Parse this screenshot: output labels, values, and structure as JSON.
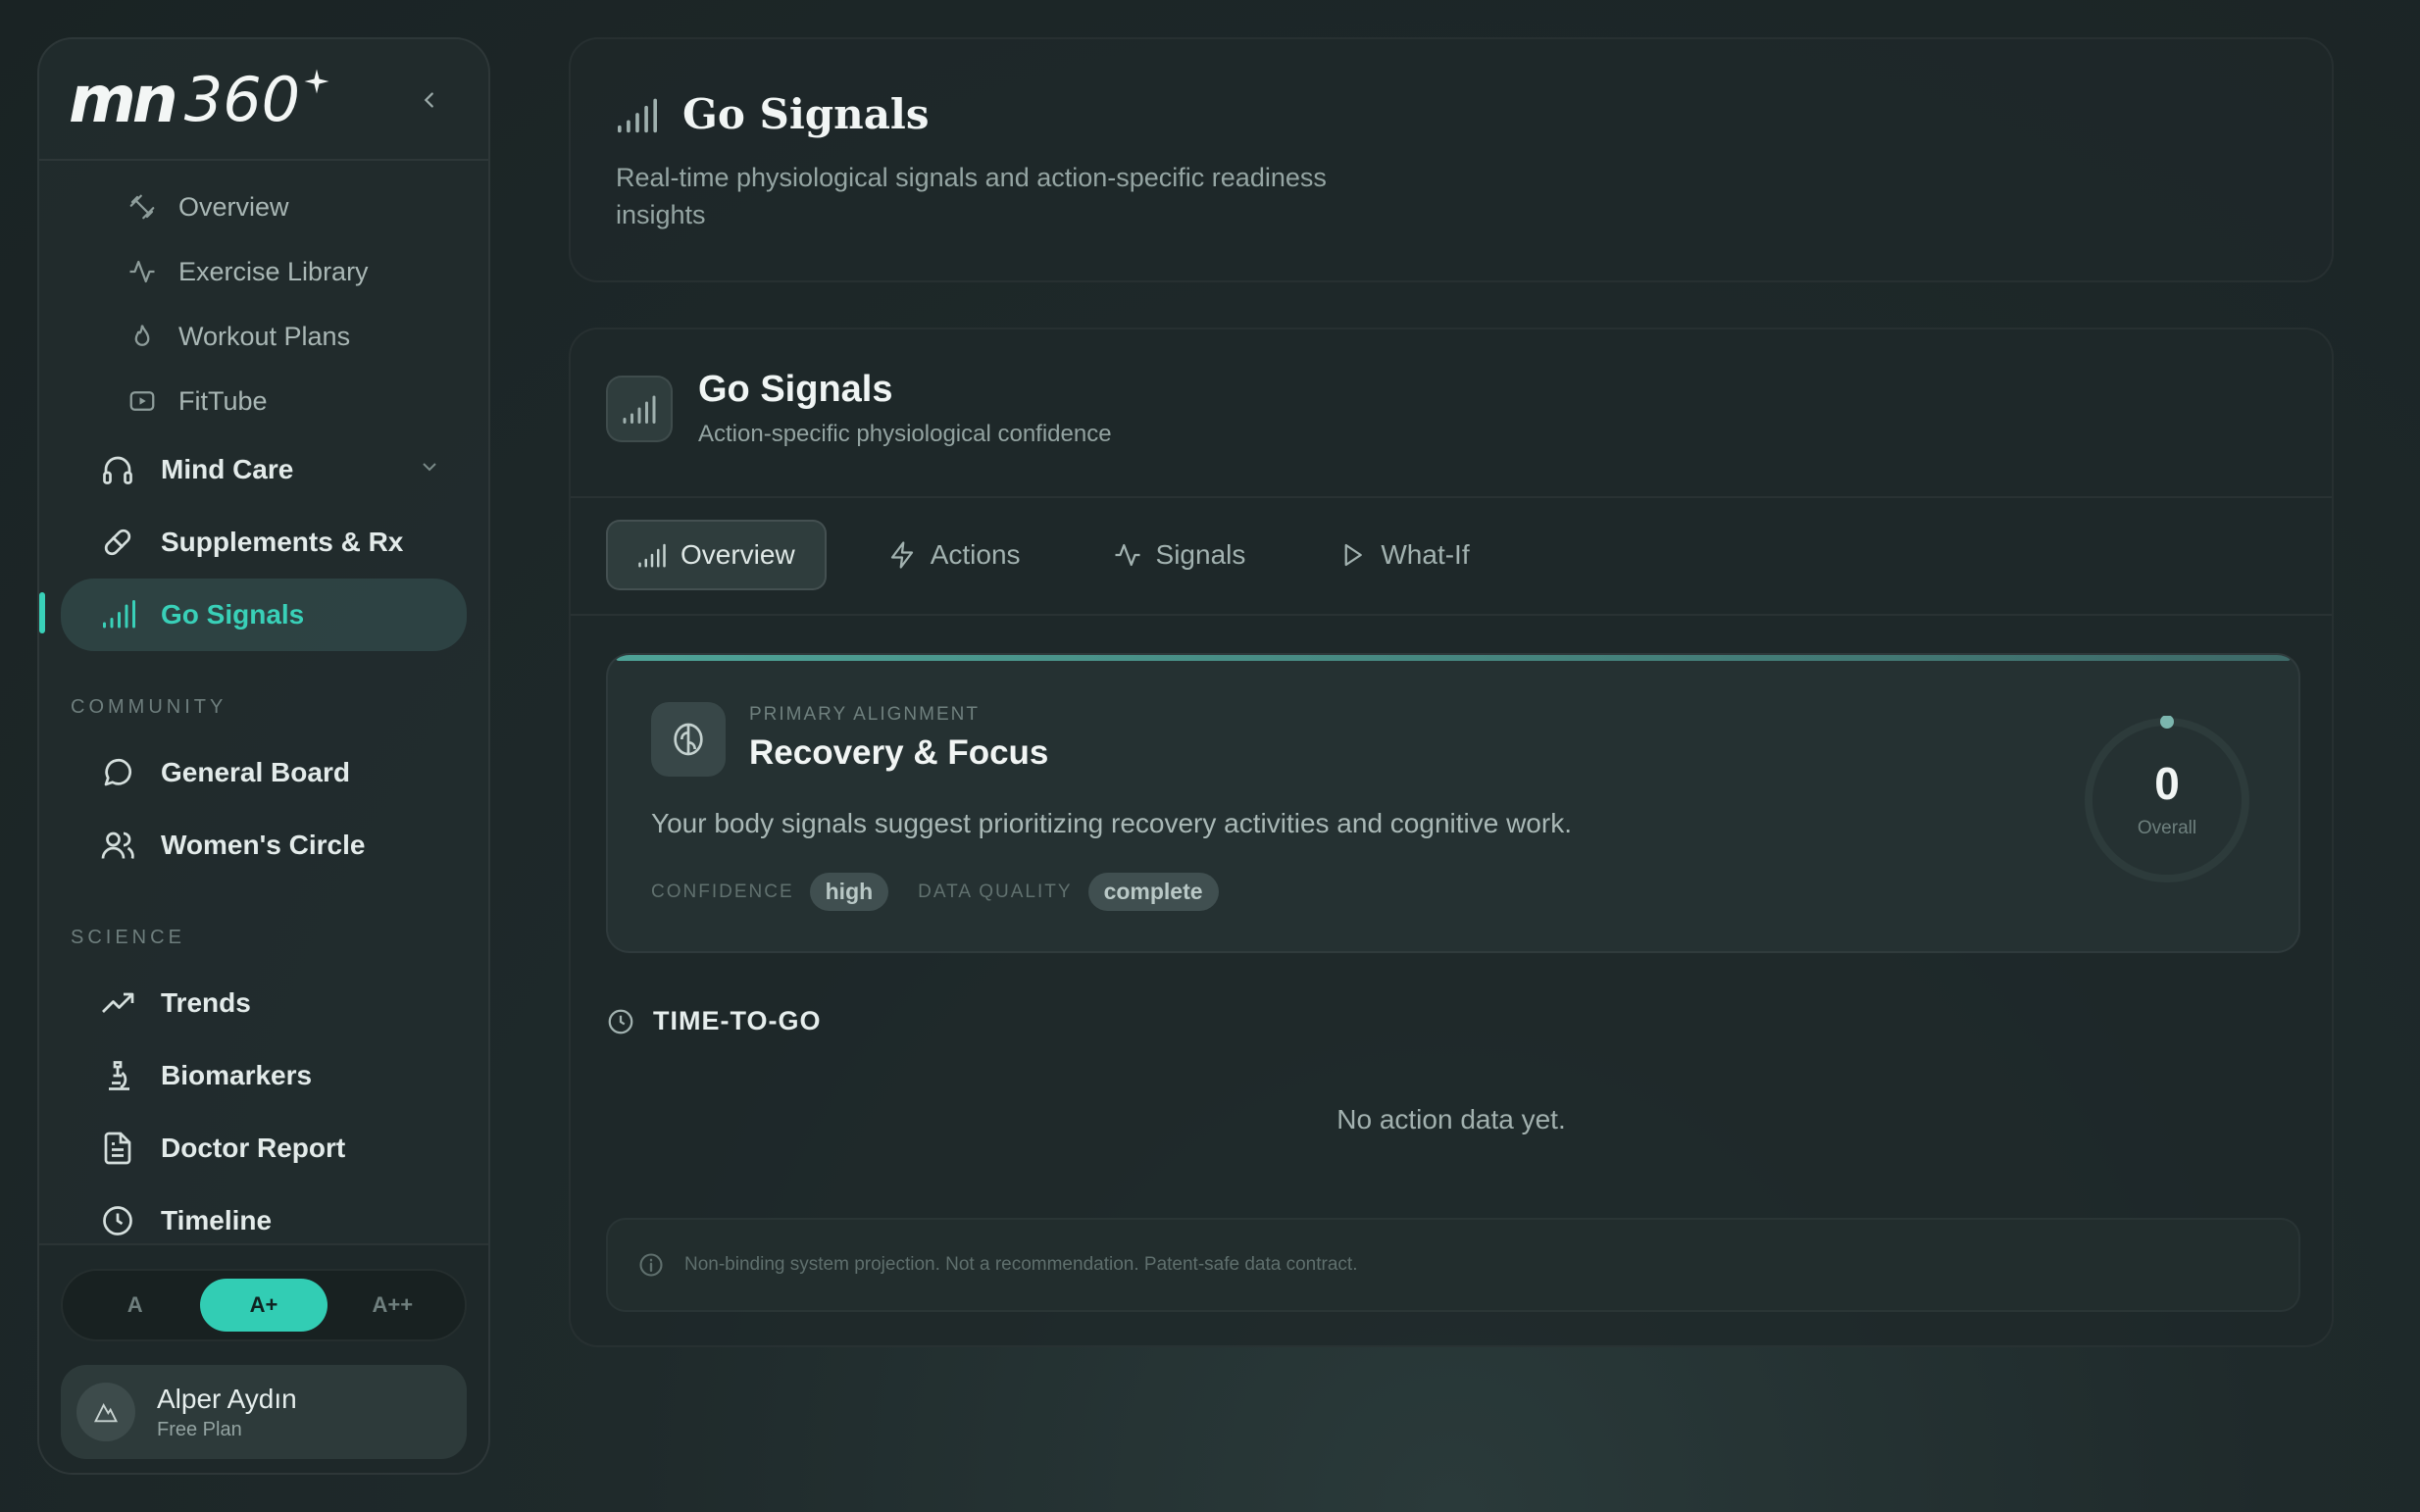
{
  "brand": {
    "mn": "mn",
    "num": "360"
  },
  "sidebar": {
    "sub_items": [
      {
        "label": "Overview",
        "icon": "dumbbell-icon"
      },
      {
        "label": "Exercise Library",
        "icon": "activity-icon"
      },
      {
        "label": "Workout Plans",
        "icon": "flame-icon"
      },
      {
        "label": "FitTube",
        "icon": "video-icon"
      }
    ],
    "items": [
      {
        "label": "Mind Care",
        "icon": "headphones-icon"
      },
      {
        "label": "Supplements & Rx",
        "icon": "pill-icon"
      },
      {
        "label": "Go Signals",
        "icon": "signal-icon"
      }
    ],
    "community_label": "COMMUNITY",
    "community": [
      {
        "label": "General Board",
        "icon": "message-circle-icon"
      },
      {
        "label": "Women's Circle",
        "icon": "users-icon"
      }
    ],
    "science_label": "SCIENCE",
    "science": [
      {
        "label": "Trends",
        "icon": "trending-up-icon"
      },
      {
        "label": "Biomarkers",
        "icon": "microscope-icon"
      },
      {
        "label": "Doctor Report",
        "icon": "file-text-icon"
      },
      {
        "label": "Timeline",
        "icon": "clock-icon"
      }
    ],
    "text_size": {
      "options": [
        "A",
        "A+",
        "A++"
      ],
      "selected": "A+"
    },
    "user": {
      "name": "Alper Aydın",
      "plan": "Free Plan"
    }
  },
  "header": {
    "title": "Go Signals",
    "subtitle": "Real-time physiological signals and action-specific readiness insights"
  },
  "panel": {
    "title": "Go Signals",
    "subtitle": "Action-specific physiological confidence",
    "tabs": [
      {
        "label": "Overview",
        "icon": "signal-icon"
      },
      {
        "label": "Actions",
        "icon": "zap-icon"
      },
      {
        "label": "Signals",
        "icon": "activity-icon"
      },
      {
        "label": "What-If",
        "icon": "play-icon"
      }
    ],
    "selected_tab": "Overview",
    "alignment": {
      "label": "PRIMARY ALIGNMENT",
      "title": "Recovery & Focus",
      "description": "Your body signals suggest prioritizing recovery activities and cognitive work.",
      "confidence_label": "CONFIDENCE",
      "confidence": "high",
      "quality_label": "DATA QUALITY",
      "quality": "complete",
      "score": "0",
      "score_label": "Overall"
    },
    "time_to_go_label": "TIME-TO-GO",
    "empty_text": "No action data yet.",
    "disclaimer": "Non-binding system projection. Not a recommendation. Patent-safe data contract."
  },
  "colors": {
    "accent": "#39d0b8",
    "background": "#1f2a2b"
  }
}
